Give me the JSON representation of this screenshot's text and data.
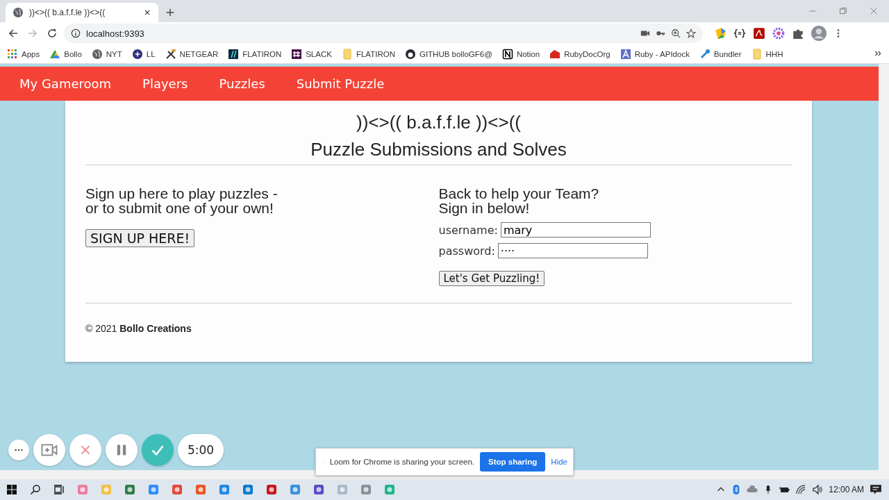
{
  "browser": {
    "tab": {
      "title": "))<>(( b.a.f.f.le ))<>(("
    },
    "address": "localhost:9393",
    "bookmarks": [
      "Apps",
      "Bollo",
      "NYT",
      "LL",
      "NETGEAR",
      "FLATIRON",
      "SLACK",
      "FLATIRON",
      "GITHUB bolloGF6@",
      "Notion",
      "RubyDocOrg",
      "Ruby - APIdock",
      "Bundler",
      "HHH"
    ]
  },
  "navbar": {
    "items": [
      "My Gameroom",
      "Players",
      "Puzzles",
      "Submit Puzzle"
    ]
  },
  "page": {
    "logo": "))<>(( b.a.f.f.le ))<>((",
    "heading": "Puzzle Submissions and Solves",
    "signup": {
      "lines": [
        "Sign up here to play puzzles -",
        "or to submit one of your own!"
      ],
      "button": "SIGN UP HERE!"
    },
    "signin": {
      "lines": [
        "Back to help your Team?",
        "Sign in below!"
      ],
      "username_label": "username:",
      "username": "mary",
      "password_label": "password:",
      "password_mask": "····",
      "button": "Let's Get Puzzling!"
    },
    "footer": "© 2021 **Bollo Creations**"
  },
  "loom": {
    "timer": "5:00",
    "notice": "Loom for Chrome is sharing your screen.",
    "stop": "Stop sharing",
    "hide": "Hide"
  },
  "taskbar": {
    "time": "12:00 AM"
  }
}
